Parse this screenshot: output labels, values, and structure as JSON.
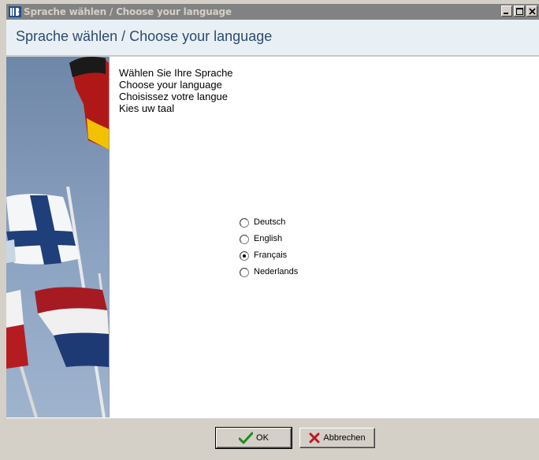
{
  "window": {
    "title": "Sprache wählen / Choose your language",
    "controls": [
      "minimize-icon",
      "maximize-icon",
      "close-icon"
    ]
  },
  "header": {
    "title": "Sprache wählen / Choose your language"
  },
  "intro": {
    "line1": "Wählen Sie Ihre Sprache",
    "line2": "Choose your language",
    "line3": "Choisissez votre langue",
    "line4": "Kies uw taal"
  },
  "languages": {
    "options": [
      {
        "label": "Deutsch",
        "selected": false
      },
      {
        "label": "English",
        "selected": false
      },
      {
        "label": "Français",
        "selected": true
      },
      {
        "label": "Nederlands",
        "selected": false
      }
    ]
  },
  "buttons": {
    "ok_label": "OK",
    "cancel_label": "Abbrechen"
  },
  "colors": {
    "header_bg": "#e8f0f6",
    "header_text": "#2c4a6e",
    "titlebar_inactive": "#828282",
    "face": "#d4d0c8"
  },
  "icons": {
    "ok": "check-icon",
    "cancel": "x-icon",
    "side_image": "flags-image"
  }
}
